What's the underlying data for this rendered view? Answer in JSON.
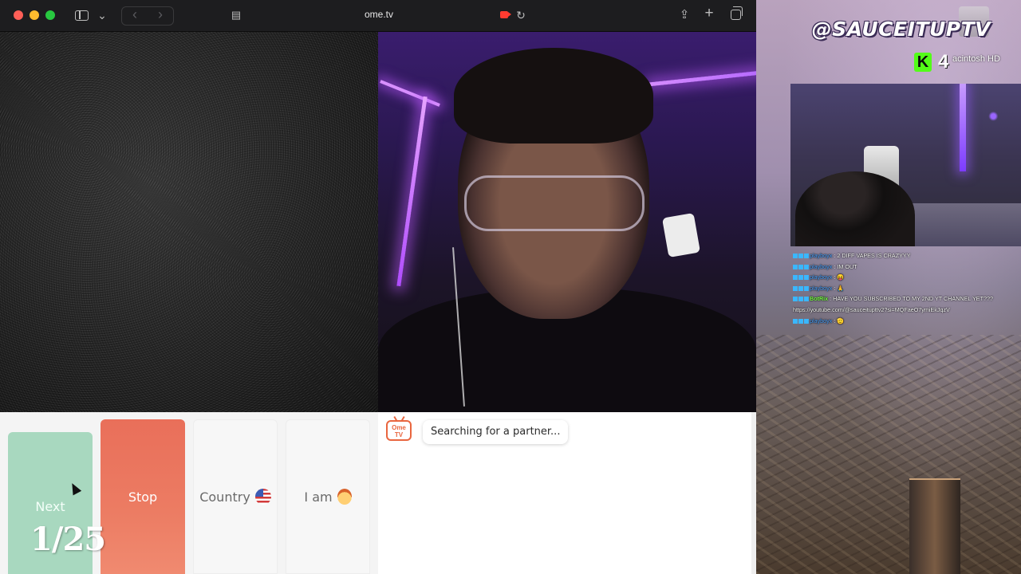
{
  "browser": {
    "url": "ome.tv",
    "icons": {
      "close": "close-window-button",
      "minimize": "minimize-window-button",
      "maximize": "maximize-window-button",
      "sidebar": "sidebar-toggle-icon",
      "sidebar_chevron": "chevron-down-icon",
      "back": "back-arrow-icon",
      "forward": "forward-arrow-icon",
      "page_menu": "page-menu-icon",
      "camera_active": "camera-recording-icon",
      "reload": "reload-icon",
      "share": "share-icon",
      "new_tab": "plus-icon",
      "tab_overview": "tab-overview-icon"
    },
    "glyphs": {
      "chevron_down": "⌄",
      "back": "‹",
      "forward": "›",
      "reload": "↻",
      "share": "⇪",
      "new_tab": "+",
      "page_menu": "▤"
    }
  },
  "controls": {
    "next_label": "Next",
    "stop_label": "Stop",
    "country_label": "Country",
    "country_flag": "us-flag-icon",
    "iam_label": "I am",
    "iam_icon": "boy-emoji-icon",
    "colors": {
      "next": "#a8d8bf",
      "stop": "#e96f5a"
    }
  },
  "chat": {
    "status_message": "Searching for a partner...",
    "logo_text_top": "Ome",
    "logo_text_bottom": "TV"
  },
  "overlay": {
    "handle": "@SAUCEITUPTV",
    "kick_logo": "K",
    "viewer_count": "4",
    "disk_label": "acintosh HD",
    "session_counter": "1/25",
    "stream_chat": [
      {
        "user": "playboyx",
        "message": ": 2 DIFF VAPES IS CRAZYYY"
      },
      {
        "user": "playboyx",
        "message": ": IM OUT"
      },
      {
        "user": "playboyx",
        "message": ": 😝"
      },
      {
        "user": "playboyx",
        "message": ": 🙏"
      },
      {
        "user": "BotRix",
        "message": ": HAVE YOU SUBSCRIBED TO MY 2ND YT CHANNEL YET???",
        "is_bot": true
      },
      {
        "user": "",
        "message": "https://youtube.com/@sauceitupttv2?si=MQFaeO7ymiEkJqzV"
      },
      {
        "user": "playboyx",
        "message": ": 🫡"
      }
    ]
  }
}
